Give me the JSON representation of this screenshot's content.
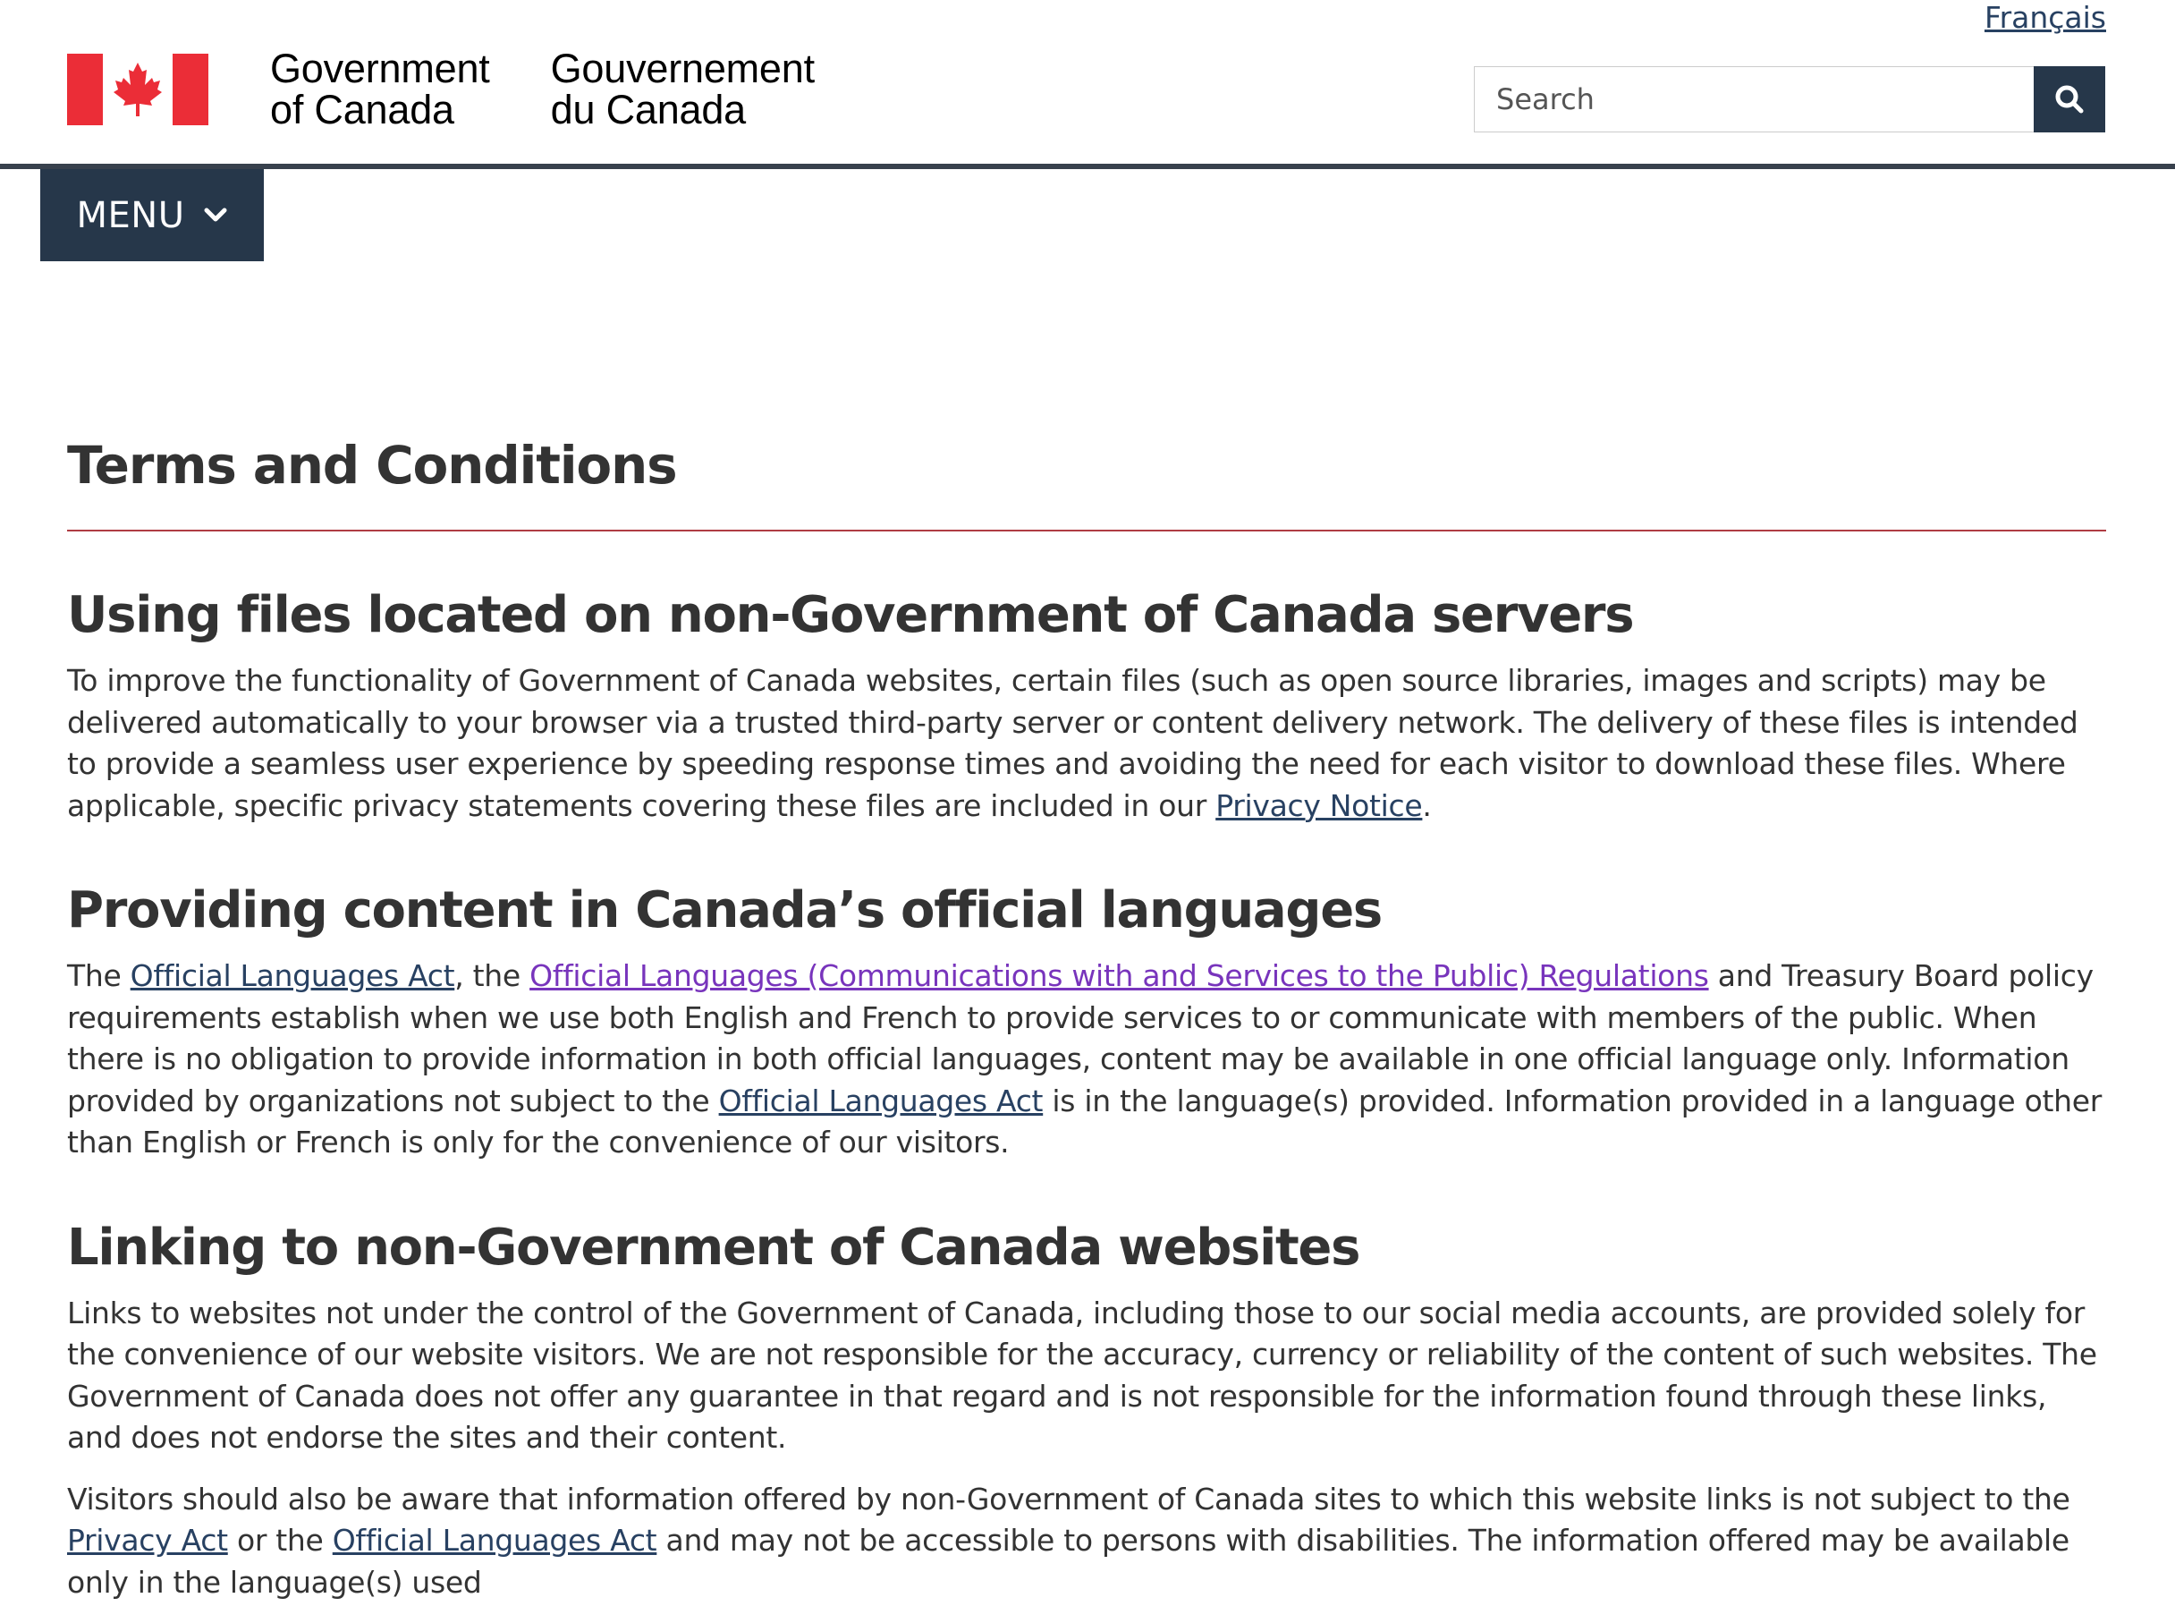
{
  "header": {
    "language_link": "Français",
    "wordmark_en_line1": "Government",
    "wordmark_en_line2": "of Canada",
    "wordmark_fr_line1": "Gouvernement",
    "wordmark_fr_line2": "du Canada",
    "search_placeholder": "Search",
    "menu_label": "MENU",
    "colors": {
      "flag_red": "#EB2D37",
      "nav_dark": "#26374A",
      "rule": "#38414D",
      "link": "#284162",
      "link_visited": "#7834BC",
      "title_rule": "#AF3C43"
    },
    "icons": [
      "canada-flag-icon",
      "search-icon",
      "chevron-down-icon"
    ]
  },
  "main": {
    "title": "Terms and Conditions",
    "s1": {
      "heading": "Using files located on non-Government of Canada servers",
      "p1_text": "To improve the functionality of Government of Canada websites, certain files (such as open source libraries, images and scripts) may be delivered automatically to your browser via a trusted third-party server or content delivery network. The delivery of these files is intended to provide a seamless user experience by speeding response times and avoiding the need for each visitor to download these files. Where applicable, specific privacy statements covering these files are included in our ",
      "p1_link": "Privacy Notice",
      "p1_end": "."
    },
    "s2": {
      "heading": "Providing content in Canada’s official languages",
      "t1": "The ",
      "link1": "Official Languages Act",
      "t2": ", the ",
      "link2": "Official Languages (Communications with and Services to the Public) Regulations",
      "t3": " and Treasury Board policy requirements establish when we use both English and French to provide services to or communicate with members of the public. When there is no obligation to provide information in both official languages, content may be available in one official language only. Information provided by organizations not subject to the ",
      "link3": "Official Languages Act",
      "t4": " is in the language(s) provided. Information provided in a language other than English or French is only for the convenience of our visitors."
    },
    "s3": {
      "heading": "Linking to non-Government of Canada websites",
      "p1": "Links to websites not under the control of the Government of Canada, including those to our social media accounts, are provided solely for the convenience of our website visitors. We are not responsible for the accuracy, currency or reliability of the content of such websites. The Government of Canada does not offer any guarantee in that regard and is not responsible for the information found through these links, and does not endorse the sites and their content.",
      "p2_t1": "Visitors should also be aware that information offered by non-Government of Canada sites to which this website links is not subject to the ",
      "p2_link1": "Privacy Act",
      "p2_t2": " or the ",
      "p2_link2": "Official Languages Act",
      "p2_t3": " and may not be accessible to persons with disabilities. The information offered may be available only in the language(s) used"
    }
  }
}
